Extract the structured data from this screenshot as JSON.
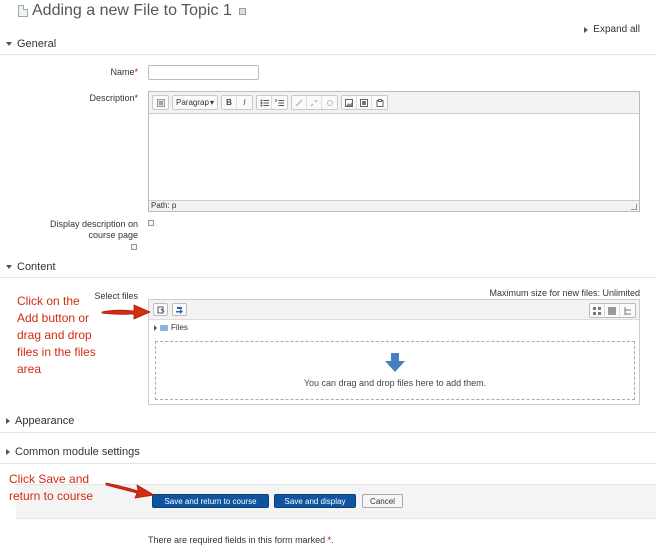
{
  "page": {
    "title": "Adding a new File to Topic 1",
    "expand_all": "Expand all",
    "required_note_prefix": "There are required fields in this form marked",
    "required_mark": "*",
    "required_note_suffix": "."
  },
  "sections": {
    "general": "General",
    "content": "Content",
    "appearance": "Appearance",
    "common_module": "Common module settings"
  },
  "fields": {
    "name_label": "Name",
    "name_value": "",
    "description_label": "Description",
    "display_desc_label_1": "Display description on",
    "display_desc_label_2": "course page",
    "select_files_label": "Select files",
    "max_size_text": "Maximum size for new files: Unlimited"
  },
  "editor": {
    "paragraph_select": "Paragrap",
    "bold": "B",
    "italic": "I",
    "path_text": "Path: p"
  },
  "filemanager": {
    "path_label": "Files",
    "drop_text": "You can drag and drop files here to add them."
  },
  "buttons": {
    "save_return": "Save and return to course",
    "save_display": "Save and display",
    "cancel": "Cancel"
  },
  "annotations": {
    "add_files_lines": [
      "Click on the",
      "Add button or",
      "drag and drop",
      "files in the files",
      "area"
    ],
    "save_lines": [
      "Click Save and",
      "return to course"
    ]
  },
  "colors": {
    "primary_button": "#0f54a0",
    "annotation_text": "#d42b12",
    "annotation_arrow": "#d42b12",
    "required_mark": "#cc0000",
    "drop_arrow": "#4a7ec2"
  },
  "icons": [
    "document-icon",
    "help-icon",
    "expand-triangle-icon",
    "collapse-triangle-icon",
    "add-file-icon",
    "download-icon",
    "folder-icon",
    "drop-arrow-icon",
    "annotation-arrow-icon"
  ]
}
